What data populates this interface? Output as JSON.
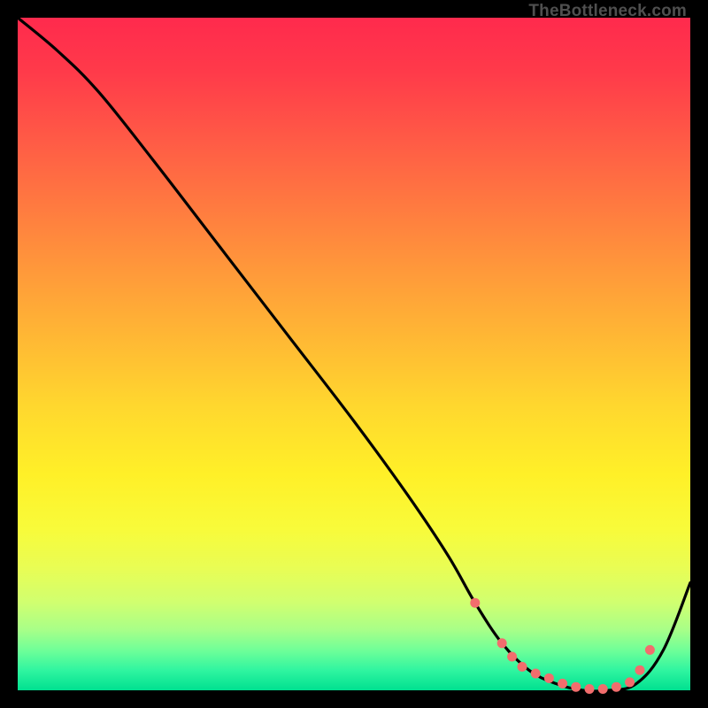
{
  "attribution": "TheBottleneck.com",
  "chart_data": {
    "type": "line",
    "title": "",
    "xlabel": "",
    "ylabel": "",
    "xlim": [
      0,
      100
    ],
    "ylim": [
      0,
      100
    ],
    "series": [
      {
        "name": "bottleneck-curve",
        "x": [
          0,
          6,
          12,
          20,
          30,
          40,
          50,
          58,
          64,
          68,
          72,
          76,
          80,
          84,
          88,
          92,
          96,
          100
        ],
        "y": [
          100,
          95,
          89,
          79,
          66,
          53,
          40,
          29,
          20,
          13,
          7,
          3,
          1,
          0,
          0,
          1,
          6,
          16
        ]
      }
    ],
    "markers": {
      "name": "highlight-dots",
      "color": "#f26d6d",
      "x": [
        68,
        72,
        73.5,
        75,
        77,
        79,
        81,
        83,
        85,
        87,
        89,
        91,
        92.5,
        94
      ],
      "y": [
        13,
        7,
        5,
        3.5,
        2.5,
        1.8,
        1,
        0.5,
        0.2,
        0.2,
        0.5,
        1.2,
        3,
        6
      ]
    }
  }
}
